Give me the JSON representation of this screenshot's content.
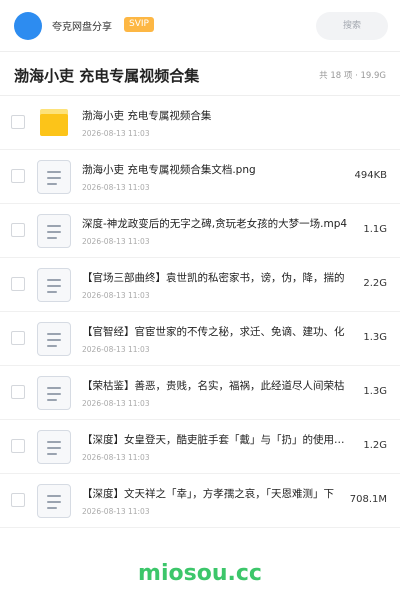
{
  "header": {
    "user_name": "夸克网盘分享",
    "badge": "SVIP",
    "search_placeholder": "搜索"
  },
  "page": {
    "title": "渤海小吏 充电专属视频合集",
    "summary": "共 18 项 · 19.9G"
  },
  "files": [
    {
      "type": "folder",
      "name": "渤海小吏 充电专属视频合集",
      "date": "2026-08-13 11:03",
      "size": ""
    },
    {
      "type": "file",
      "name": "渤海小吏 充电专属视频合集文档.png",
      "date": "2026-08-13 11:03",
      "size": "494KB"
    },
    {
      "type": "file",
      "name": "深度-神龙政变后的无字之碑,贪玩老女孩的大梦一场.mp4",
      "date": "2026-08-13 11:03",
      "size": "1.1G"
    },
    {
      "type": "file",
      "name": "【官场三部曲终】袁世凯的私密家书，谤，伪，降，揣的",
      "date": "2026-08-13 11:03",
      "size": "2.2G"
    },
    {
      "type": "file",
      "name": "【官智经】官宦世家的不传之秘，求迁、免谪、建功、化",
      "date": "2026-08-13 11:03",
      "size": "1.3G"
    },
    {
      "type": "file",
      "name": "【荣枯鉴】善恶，贵贱，名实，福祸，此经道尽人间荣枯",
      "date": "2026-08-13 11:03",
      "size": "1.3G"
    },
    {
      "type": "file",
      "name": "【深度】女皇登天，酷吏脏手套「戴」与「扔」的使用说明",
      "date": "2026-08-13 11:03",
      "size": "1.2G"
    },
    {
      "type": "file",
      "name": "【深度】文天祥之「幸」，方孝孺之哀，「天恩难测」下",
      "date": "2026-08-13 11:03",
      "size": "708.1M"
    }
  ],
  "footer": {
    "brand": "miosou.cc"
  },
  "colors": {
    "accent": "#2d8cf0",
    "badge": "#fdb744",
    "folder": "#fcc419",
    "brand": "#3cc66a"
  },
  "icons": {
    "folder": "folder-icon",
    "file": "document-icon"
  }
}
